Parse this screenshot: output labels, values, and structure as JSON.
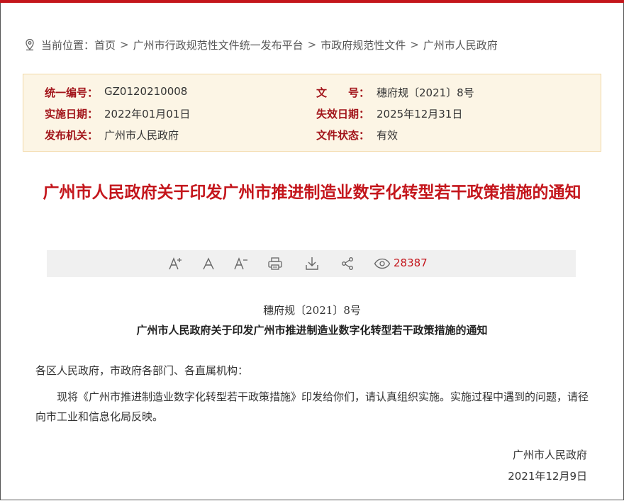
{
  "breadcrumb": {
    "prefix": "当前位置：",
    "items": [
      "首页",
      "广州市行政规范性文件统一发布平台",
      "市政府规范性文件",
      "广州市人民政府"
    ],
    "separator": ">"
  },
  "info": {
    "unified_no_label": "统一编号：",
    "unified_no": "GZ0120210008",
    "doc_no_label": "文　　号：",
    "doc_no": "穗府规〔2021〕8号",
    "effective_label": "实施日期：",
    "effective_date": "2022年01月01日",
    "expiry_label": "失效日期：",
    "expiry_date": "2025年12月31日",
    "issuer_label": "发布机关：",
    "issuer": "广州市人民政府",
    "status_label": "文件状态：",
    "status": "有效"
  },
  "title": "广州市人民政府关于印发广州市推进制造业数字化转型若干政策措施的通知",
  "toolbar": {
    "icons": [
      "font-increase-icon",
      "font-normal-icon",
      "font-decrease-icon",
      "print-icon",
      "download-icon",
      "share-icon",
      "eye-icon"
    ],
    "views": "28387"
  },
  "document": {
    "number": "穗府规〔2021〕8号",
    "subtitle": "广州市人民政府关于印发广州市推进制造业数字化转型若干政策措施的通知",
    "salutation": "各区人民政府，市政府各部门、各直属机构：",
    "body": "现将《广州市推进制造业数字化转型若干政策措施》印发给你们，请认真组织实施。实施过程中遇到的问题，请径向市工业和信息化局反映。",
    "signature": "广州市人民政府",
    "date": "2021年12月9日"
  },
  "colors": {
    "accent": "#c4161c",
    "label": "#a2141a",
    "info_bg": "#fcf5e5",
    "toolbar_bg": "#f0f0f0"
  }
}
